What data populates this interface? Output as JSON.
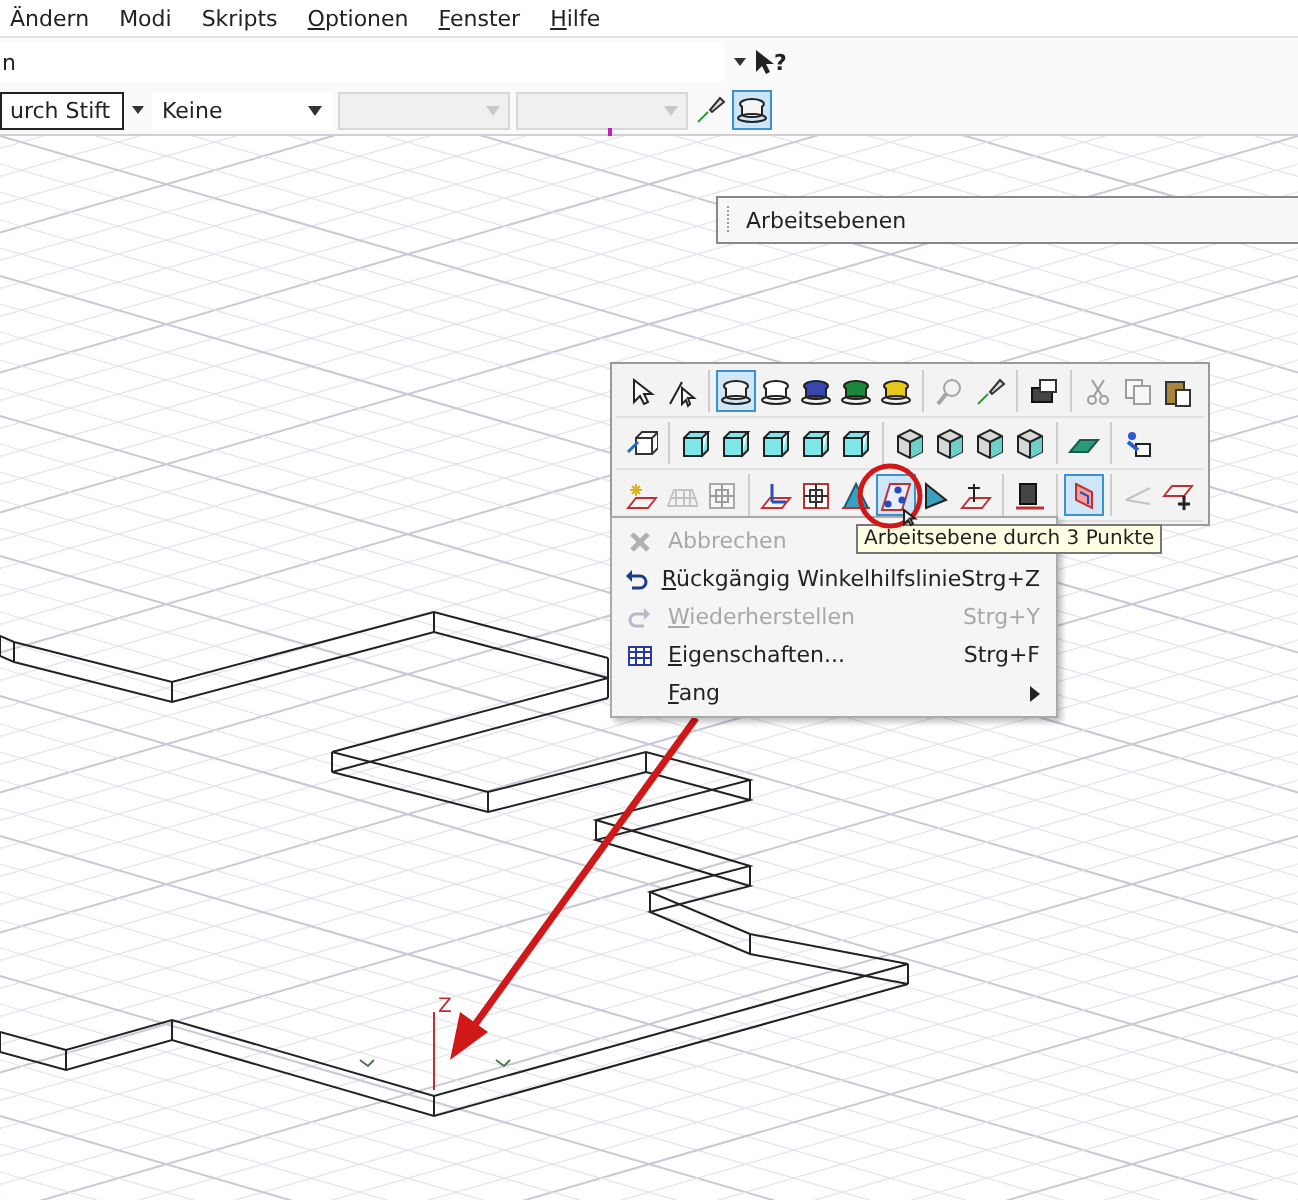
{
  "menu_bar": [
    {
      "label": "Ändern",
      "underlined_initial": false
    },
    {
      "label": "Modi",
      "underlined_initial": false
    },
    {
      "label": "Skripts",
      "underlined_initial": false
    },
    {
      "label": "Optionen",
      "underlined_initial": true
    },
    {
      "label": "Fenster",
      "underlined_initial": true
    },
    {
      "label": "Hilfe",
      "underlined_initial": true
    }
  ],
  "command_field": {
    "value": "n"
  },
  "help_button": {
    "label": "?"
  },
  "property_bar": {
    "combos": [
      {
        "value": "urch Stift",
        "disabled": false
      },
      {
        "value": "Keine",
        "disabled": false
      },
      {
        "disabled": true
      },
      {
        "disabled": true
      }
    ],
    "layer_button": {
      "selected": true
    }
  },
  "workplane_panel": {
    "title": "Arbeitsebenen"
  },
  "palette": {
    "rows": [
      [
        [
          {
            "kind": "pointer",
            "selected": false,
            "disabled": false
          },
          {
            "kind": "pointer-line",
            "selected": false,
            "disabled": false
          }
        ],
        [
          {
            "kind": "cup",
            "selected": true,
            "disabled": false,
            "color": "#f4f4f4"
          },
          {
            "kind": "cup",
            "selected": false,
            "disabled": false,
            "color": "#ffffff"
          },
          {
            "kind": "cup",
            "selected": false,
            "disabled": false,
            "color": "#3848b0"
          },
          {
            "kind": "cup",
            "selected": false,
            "disabled": false,
            "color": "#1a8a3a"
          },
          {
            "kind": "cup",
            "selected": false,
            "disabled": false,
            "color": "#e8c81a"
          }
        ],
        [
          {
            "kind": "lens",
            "selected": false,
            "disabled": true
          },
          {
            "kind": "pen",
            "selected": false,
            "disabled": false
          }
        ],
        [
          {
            "kind": "camera",
            "selected": false,
            "disabled": false
          }
        ],
        [
          {
            "kind": "scissors",
            "selected": false,
            "disabled": true
          },
          {
            "kind": "copy",
            "selected": false,
            "disabled": true
          },
          {
            "kind": "paste",
            "selected": false,
            "disabled": false
          }
        ]
      ],
      [
        [
          {
            "kind": "cube-arrow",
            "selected": false,
            "disabled": false
          }
        ],
        [
          {
            "kind": "cube",
            "selected": false,
            "disabled": false
          },
          {
            "kind": "cube",
            "selected": false,
            "disabled": false
          },
          {
            "kind": "cube",
            "selected": false,
            "disabled": false
          },
          {
            "kind": "cube",
            "selected": false,
            "disabled": false
          },
          {
            "kind": "cube",
            "selected": false,
            "disabled": false
          }
        ],
        [
          {
            "kind": "cube-shaded",
            "selected": false,
            "disabled": false
          },
          {
            "kind": "cube-shaded",
            "selected": false,
            "disabled": false
          },
          {
            "kind": "cube-shaded",
            "selected": false,
            "disabled": false
          },
          {
            "kind": "cube-shaded",
            "selected": false,
            "disabled": false
          }
        ],
        [
          {
            "kind": "plane",
            "selected": false,
            "disabled": false
          }
        ],
        [
          {
            "kind": "figure",
            "selected": false,
            "disabled": false
          }
        ]
      ],
      [
        [
          {
            "kind": "plane-star",
            "selected": false,
            "disabled": false
          },
          {
            "kind": "plane-grid",
            "selected": false,
            "disabled": true
          },
          {
            "kind": "square-grid",
            "selected": false,
            "disabled": true
          }
        ],
        [
          {
            "kind": "plane-axes",
            "selected": false,
            "disabled": false
          },
          {
            "kind": "square-grid",
            "selected": false,
            "disabled": false
          },
          {
            "kind": "pyramid",
            "selected": false,
            "disabled": false
          },
          {
            "kind": "plane-points",
            "selected": true,
            "disabled": false
          },
          {
            "kind": "wedge",
            "selected": false,
            "disabled": false
          },
          {
            "kind": "plane-up",
            "selected": false,
            "disabled": false
          }
        ],
        [
          {
            "kind": "book",
            "selected": false,
            "disabled": false
          }
        ],
        [
          {
            "kind": "plane-box",
            "selected": true,
            "disabled": false
          }
        ],
        [
          {
            "kind": "angle",
            "selected": false,
            "disabled": true
          },
          {
            "kind": "plane-cross",
            "selected": false,
            "disabled": false
          }
        ]
      ]
    ]
  },
  "tooltip": {
    "text": "Arbeitsebene durch 3 Punkte"
  },
  "context_menu": {
    "items": [
      {
        "kind": "cancel",
        "label": "Abbrechen",
        "disabled": true,
        "underlined_initial": false,
        "submenu": false
      },
      {
        "kind": "undo",
        "label": "Rückgängig Winkelhilfslinie",
        "shortcut": "Strg+Z",
        "disabled": false,
        "underlined_initial": true,
        "submenu": false
      },
      {
        "kind": "redo",
        "label": "Wiederherstellen",
        "shortcut": "Strg+Y",
        "disabled": true,
        "underlined_initial": true,
        "submenu": false
      },
      {
        "kind": "table",
        "label": "Eigenschaften...",
        "shortcut": "Strg+F",
        "disabled": false,
        "underlined_initial": true,
        "submenu": false
      },
      {
        "kind": "none",
        "label": "Fang",
        "disabled": false,
        "underlined_initial": true,
        "submenu": true
      }
    ]
  },
  "axis_indicator": {
    "label": "Z"
  }
}
